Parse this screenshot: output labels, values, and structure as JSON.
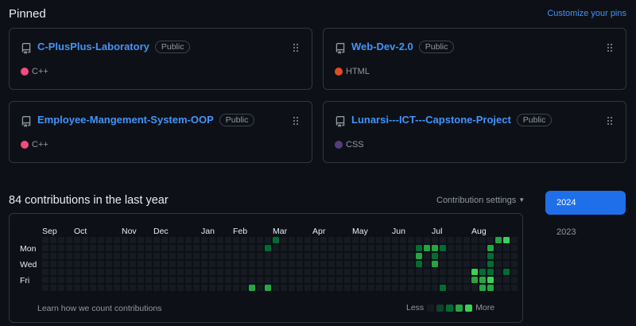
{
  "pinned": {
    "heading": "Pinned",
    "customize_label": "Customize your pins",
    "repos": [
      {
        "name": "C-PlusPlus-Laboratory",
        "badge": "Public",
        "language": "C++",
        "lang_color": "#f34b7d"
      },
      {
        "name": "Web-Dev-2.0",
        "badge": "Public",
        "language": "HTML",
        "lang_color": "#e34c26"
      },
      {
        "name": "Employee-Mangement-System-OOP",
        "badge": "Public",
        "language": "C++",
        "lang_color": "#f34b7d"
      },
      {
        "name": "Lunarsi---ICT---Capstone-Project",
        "badge": "Public",
        "language": "CSS",
        "lang_color": "#563d7c"
      }
    ]
  },
  "contributions": {
    "heading": "84 contributions in the last year",
    "settings_label": "Contribution settings",
    "months": [
      "Sep",
      "Oct",
      "Nov",
      "Dec",
      "Jan",
      "Feb",
      "Mar",
      "Apr",
      "May",
      "Jun",
      "Jul",
      "Aug"
    ],
    "days": [
      "Mon",
      "Wed",
      "Fri"
    ],
    "learn_label": "Learn how we count contributions",
    "legend_less": "Less",
    "legend_more": "More",
    "level_colors": [
      "#161b22",
      "#0e4429",
      "#006d32",
      "#26a641",
      "#39d353"
    ],
    "active_cells": [
      {
        "week": 29,
        "day": 0,
        "level": 2
      },
      {
        "week": 26,
        "day": 6,
        "level": 3
      },
      {
        "week": 28,
        "day": 1,
        "level": 2
      },
      {
        "week": 28,
        "day": 6,
        "level": 3
      },
      {
        "week": 47,
        "day": 1,
        "level": 2
      },
      {
        "week": 47,
        "day": 2,
        "level": 3
      },
      {
        "week": 47,
        "day": 3,
        "level": 2
      },
      {
        "week": 48,
        "day": 1,
        "level": 3
      },
      {
        "week": 49,
        "day": 1,
        "level": 3
      },
      {
        "week": 49,
        "day": 2,
        "level": 2
      },
      {
        "week": 49,
        "day": 3,
        "level": 3
      },
      {
        "week": 50,
        "day": 1,
        "level": 2
      },
      {
        "week": 50,
        "day": 6,
        "level": 2
      },
      {
        "week": 54,
        "day": 4,
        "level": 4
      },
      {
        "week": 54,
        "day": 5,
        "level": 3
      },
      {
        "week": 55,
        "day": 4,
        "level": 2
      },
      {
        "week": 55,
        "day": 5,
        "level": 3
      },
      {
        "week": 55,
        "day": 6,
        "level": 3
      },
      {
        "week": 56,
        "day": 1,
        "level": 3
      },
      {
        "week": 56,
        "day": 2,
        "level": 2
      },
      {
        "week": 56,
        "day": 3,
        "level": 2
      },
      {
        "week": 56,
        "day": 4,
        "level": 2
      },
      {
        "week": 56,
        "day": 5,
        "level": 4
      },
      {
        "week": 56,
        "day": 6,
        "level": 3
      },
      {
        "week": 57,
        "day": 0,
        "level": 3
      },
      {
        "week": 58,
        "day": 0,
        "level": 4
      },
      {
        "week": 58,
        "day": 4,
        "level": 2
      }
    ]
  },
  "years": [
    "2024",
    "2023"
  ]
}
